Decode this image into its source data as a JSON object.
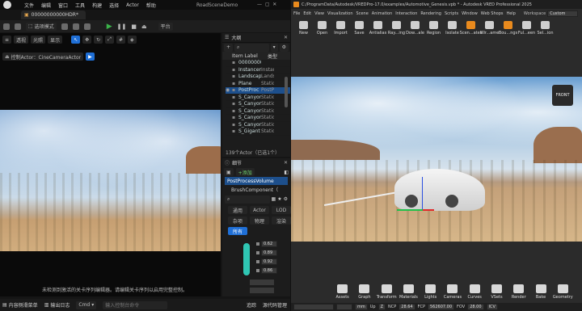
{
  "ue": {
    "menu": [
      "文件",
      "编辑",
      "窗口",
      "工具",
      "构建",
      "选择",
      "Actor",
      "帮助"
    ],
    "project": "RoadSceneDemo",
    "level_tab": "00000000000HDR*",
    "toolbar_mode": "选项模式",
    "platform": "平台",
    "vp_buttons": [
      "透视",
      "光照",
      "显示"
    ],
    "camera_label": "控制Actor：CineCameraActor",
    "status_msg": "未检测到激活的关卡序列编辑器。请编辑关卡序列以启用完整控制。",
    "bottom": {
      "drawer": "内容侧滑菜单",
      "log": "输出日志",
      "cmd": "Cmd",
      "cmd_placeholder": "输入控制台命令",
      "trace": "追踪",
      "source": "源代码管理"
    },
    "outliner": {
      "title": "大纲",
      "col_label": "Item Label",
      "col_type": "类型",
      "rows": [
        {
          "n": "00000000000HDR",
          "t": ""
        },
        {
          "n": "Instancer",
          "t": "Instan"
        },
        {
          "n": "Landscape",
          "t": "Lands"
        },
        {
          "n": "Plane",
          "t": "Static"
        },
        {
          "n": "PostProc",
          "t": "PostP"
        },
        {
          "n": "S_Canyon",
          "t": "Static"
        },
        {
          "n": "S_Canyon",
          "t": "Static"
        },
        {
          "n": "S_Canyon",
          "t": "Static"
        },
        {
          "n": "S_Canyon",
          "t": "Static"
        },
        {
          "n": "S_Canyon",
          "t": "Static"
        },
        {
          "n": "S_Gigant",
          "t": "Static"
        }
      ],
      "selected": 4,
      "count": "139个Actor（已选1个）"
    },
    "details": {
      "title": "细节",
      "add": "+添加",
      "component": "PostProcessVolume",
      "brush": "BrushComponent（",
      "filters": [
        "通用",
        "Actor",
        "LOD",
        "杂项",
        "物理",
        "渲染",
        "所有"
      ],
      "values": [
        "0.62",
        "0.89",
        "0.92",
        "0.86"
      ]
    }
  },
  "vr": {
    "title": "C:/ProgramData/Autodesk/VREDPro-17.0/examples/Automotive_Genesis.vpb * - Autodesk VRED Professional 2025",
    "menu": [
      "File",
      "Edit",
      "View",
      "Visualization",
      "Scene",
      "Animation",
      "Interaction",
      "Rendering",
      "Scripts",
      "Window",
      "Web Shops",
      "Help"
    ],
    "workspace_label": "Workspace",
    "workspace": "Custom",
    "tools": [
      "New",
      "Open",
      "Import",
      "Save",
      "Antialias",
      "Ray...ing",
      "Dow...ale",
      "Region",
      "Isolate",
      "Scen...ates",
      "Wir...ame",
      "Bou...ngs",
      "Ful...een",
      "Sel...ion"
    ],
    "viewcube": "FRONT",
    "bottom_tools": [
      "Assets",
      "Graph",
      "Transform",
      "Materials",
      "Lights",
      "Cameras",
      "Curves",
      "VSets",
      "Render",
      "Bake",
      "Geometry"
    ],
    "status": {
      "units": "mm",
      "up": "Up",
      "axis": "Z",
      "ncp_label": "NCP",
      "ncp": "28.64",
      "fcp_label": "FCP",
      "fcp": "562607.00",
      "fov_label": "FOV",
      "fov": "28.00",
      "icv": "ICV"
    }
  },
  "colors": {
    "accent_ue": "#1f6fd6",
    "accent_vr": "#e98a1d",
    "play": "#3bb34a"
  }
}
